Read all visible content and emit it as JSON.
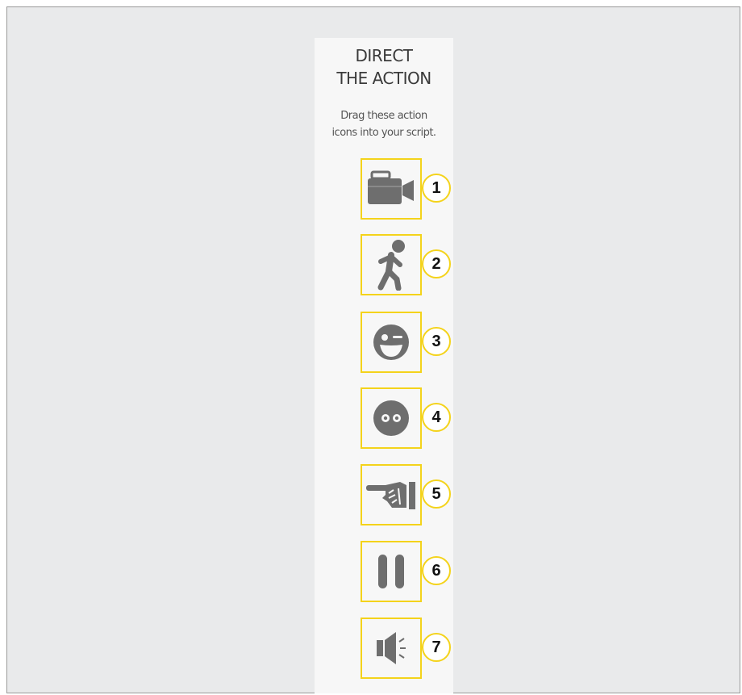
{
  "panel": {
    "title_line1": "DIRECT",
    "title_line2": "THE ACTION",
    "subtitle_line1": "Drag these action",
    "subtitle_line2": "icons into your script."
  },
  "actions": [
    {
      "number": "1",
      "icon": "camera-icon"
    },
    {
      "number": "2",
      "icon": "walking-person-icon"
    },
    {
      "number": "3",
      "icon": "winking-face-icon"
    },
    {
      "number": "4",
      "icon": "surprised-face-icon"
    },
    {
      "number": "5",
      "icon": "pointing-hand-icon"
    },
    {
      "number": "6",
      "icon": "pause-icon"
    },
    {
      "number": "7",
      "icon": "speaker-icon"
    }
  ],
  "colors": {
    "accent": "#f4d31b",
    "icon": "#6e6e6e",
    "background": "#e9eaeb",
    "panel": "#f7f7f7"
  }
}
